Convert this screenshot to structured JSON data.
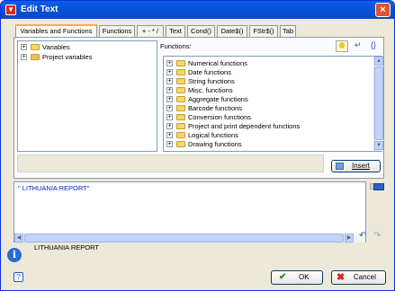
{
  "window": {
    "title": "Edit Text",
    "icon": "app-icon",
    "close_glyph": "×"
  },
  "tabs": [
    {
      "label": "Variables and Functions",
      "active": true
    },
    {
      "label": "Functions"
    },
    {
      "label": "+ - * /"
    },
    {
      "label": "Text"
    },
    {
      "label": "Cond()"
    },
    {
      "label": "Date$()"
    },
    {
      "label": "FStr$()"
    },
    {
      "label": "Tab"
    }
  ],
  "variables_tree": [
    {
      "label": "Variables",
      "icon": "folder-variables-icon"
    },
    {
      "label": "Project variables",
      "icon": "folder-project-icon"
    }
  ],
  "functions": {
    "header": "Functions:",
    "items": [
      "Numerical functions",
      "Date functions",
      "String functions",
      "Misc. functions",
      "Aggregate functions",
      "Barcode functions",
      "Conversion functions",
      "Project and print dependent functions",
      "Logical functions",
      "Drawing functions"
    ],
    "tool_icons": [
      "lightbulb-icon",
      "return-arrow-icon",
      "braces-icon"
    ]
  },
  "insert_button": {
    "label": "Insert"
  },
  "expression": {
    "value": "\" LITHUANIA REPORT\""
  },
  "result": {
    "value": "LITHUANIA REPORT"
  },
  "ok_button": {
    "label": "OK"
  },
  "cancel_button": {
    "label": "Cancel"
  },
  "colors": {
    "title_bar": "#0553d8",
    "accent_tab": "#f4b43c",
    "ok_green": "#1e8f1e",
    "cancel_red": "#d8211b"
  }
}
